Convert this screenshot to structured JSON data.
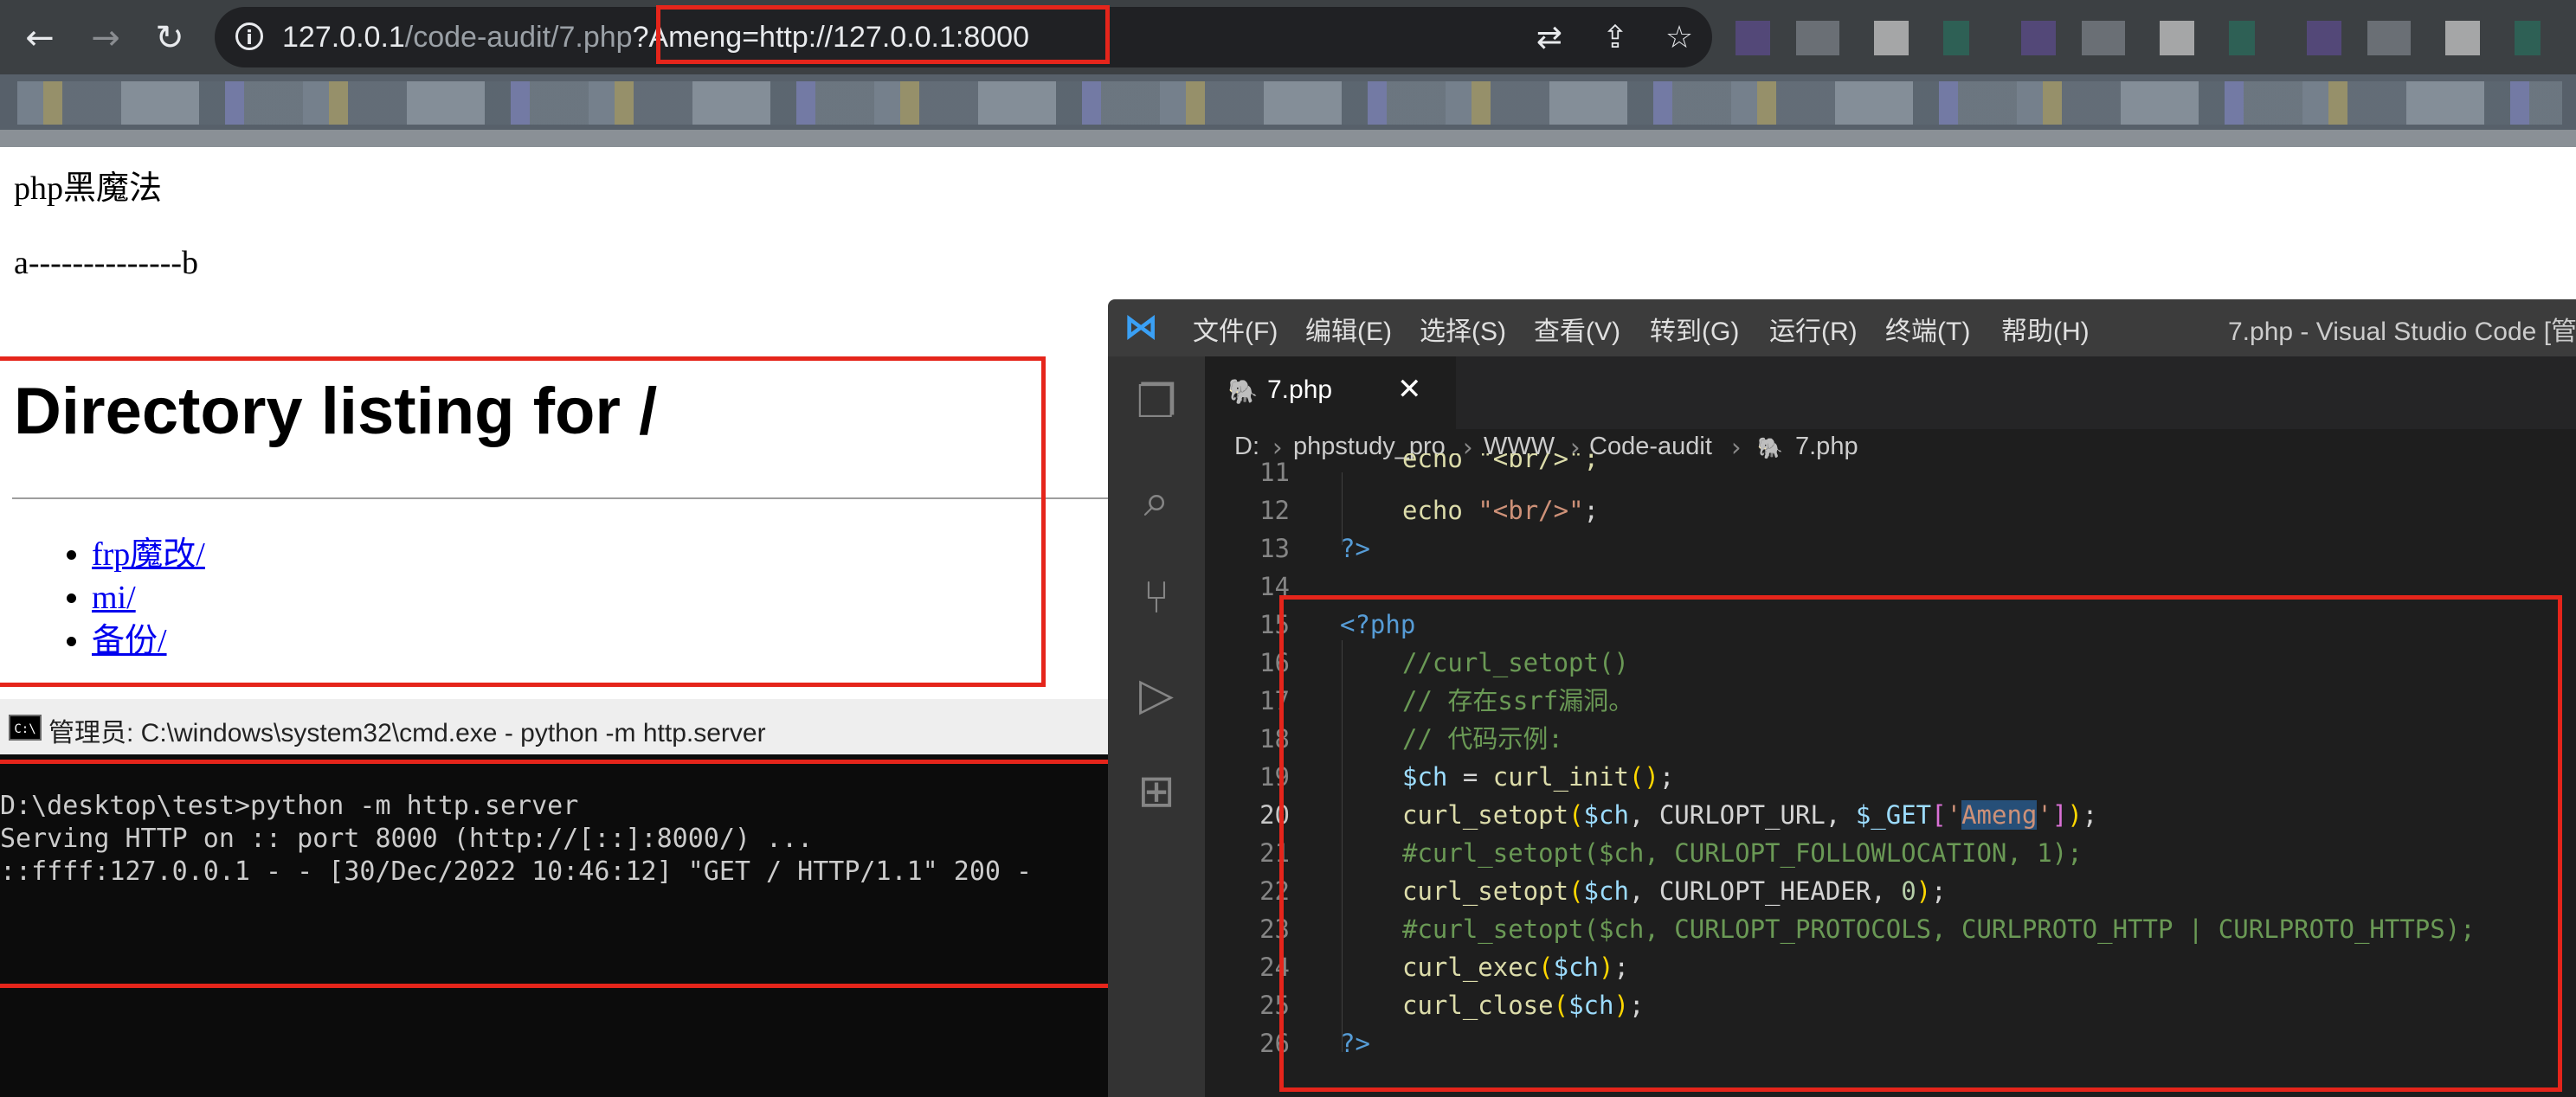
{
  "browser": {
    "url_host": "127.0.0.1",
    "url_path": "/code-audit/7.php",
    "url_query": "?Ameng=http://127.0.0.1:8000"
  },
  "page": {
    "line1": "php黑魔法",
    "line2": "a--------------b",
    "heading": "Directory listing for /",
    "links": [
      "frp魔改/",
      "mi/",
      "备份/"
    ]
  },
  "cmd": {
    "title": "管理员: C:\\windows\\system32\\cmd.exe - python  -m http.server",
    "icon_label": "C:\\",
    "lines": [
      "D:\\desktop\\test>python -m http.server",
      "Serving HTTP on :: port 8000 (http://[::]:8000/) ...",
      "::ffff:127.0.0.1 - - [30/Dec/2022 10:46:12] \"GET / HTTP/1.1\" 200 -"
    ]
  },
  "vscode": {
    "menu": [
      "文件(F)",
      "编辑(E)",
      "选择(S)",
      "查看(V)",
      "转到(G)",
      "运行(R)",
      "终端(T)",
      "帮助(H)"
    ],
    "window_title": "7.php - Visual Studio Code [管理",
    "tab_label": "7.php",
    "breadcrumb": [
      "D:",
      "phpstudy_pro",
      "WWW",
      "Code-audit",
      "7.php"
    ],
    "line_numbers": [
      "11",
      "12",
      "13",
      "14",
      "15",
      "16",
      "17",
      "18",
      "19",
      "20",
      "21",
      "22",
      "23",
      "24",
      "25",
      "26"
    ],
    "code": {
      "l11": "echo \"<br/>\";",
      "l12_echo": "echo ",
      "l12_str": "\"<br/>\"",
      "l12_end": ";",
      "l13": "?>",
      "l15": "<?php",
      "l16": "//curl_setopt()",
      "l17": "// 存在ssrf漏洞。",
      "l18": "// 代码示例:",
      "l19_var": "$ch",
      "l19_eq": " = ",
      "l19_fn": "curl_init",
      "l20_fn": "curl_setopt",
      "l20_var": "$ch",
      "l20_const": ", CURLOPT_URL, ",
      "l20_get": "$_GET",
      "l20_key": "Ameng",
      "l21": "#curl_setopt($ch, CURLOPT_FOLLOWLOCATION, 1);",
      "l22_fn": "curl_setopt",
      "l22_var": "$ch",
      "l22_const": ", CURLOPT_HEADER, ",
      "l22_num": "0",
      "l23": "#curl_setopt($ch, CURLOPT_PROTOCOLS, CURLPROTO_HTTP | CURLPROTO_HTTPS);",
      "l24_fn": "curl_exec",
      "l24_var": "$ch",
      "l25_fn": "curl_close",
      "l25_var": "$ch",
      "l26": "?>"
    }
  }
}
